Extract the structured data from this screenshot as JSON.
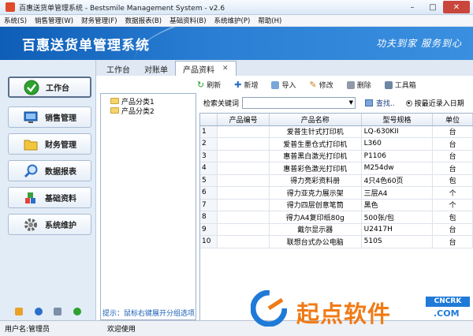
{
  "window": {
    "title": "百惠送货单管理系统 - Bestsmile Management System - v2.6",
    "controls": [
      "minimize",
      "maximize",
      "close"
    ]
  },
  "menubar": {
    "items": [
      "系统(S)",
      "销售管理(W)",
      "财务管理(F)",
      "数据报表(B)",
      "基础资料(B)",
      "系统维护(P)",
      "帮助(H)"
    ]
  },
  "banner": {
    "title": "百惠送货单管理系统",
    "slogan": "功夫到家 服务到心"
  },
  "sidebar": {
    "buttons": [
      {
        "label": "工作台",
        "icon": "check-circle-icon",
        "color": "#2ea12e"
      },
      {
        "label": "销售管理",
        "icon": "monitor-icon",
        "color": "#2a6fc9"
      },
      {
        "label": "财务管理",
        "icon": "folder-icon",
        "color": "#e8b92c"
      },
      {
        "label": "数据报表",
        "icon": "magnifier-icon",
        "color": "#2a6fc9"
      },
      {
        "label": "基础资料",
        "icon": "blocks-icon",
        "color": "#3c8f3c"
      },
      {
        "label": "系统维护",
        "icon": "gear-icon",
        "color": "#555555"
      }
    ]
  },
  "tabs": [
    {
      "label": "工作台",
      "active": false
    },
    {
      "label": "对账单",
      "active": false
    },
    {
      "label": "产品资料",
      "active": true
    }
  ],
  "toolbar": {
    "refresh": "刷新",
    "add": "新增",
    "import": "导入",
    "edit": "修改",
    "delete": "删除",
    "toolbox": "工具箱"
  },
  "tree": {
    "items": [
      "产品分类1",
      "产品分类2"
    ],
    "hint": "提示：鼠标右键展开分组选项"
  },
  "search": {
    "label": "检索关键词",
    "value": "",
    "find_label": "查找..",
    "radio_label": "按最近录入日期"
  },
  "table": {
    "headers": [
      "",
      "产品编号",
      "产品名称",
      "型号规格",
      "单位"
    ],
    "rows": [
      {
        "n": "1",
        "code": "",
        "name": "爱普生针式打印机",
        "model": "LQ-630KII",
        "unit": "台"
      },
      {
        "n": "2",
        "code": "",
        "name": "爱普生墨仓式打印机",
        "model": "L360",
        "unit": "台"
      },
      {
        "n": "3",
        "code": "",
        "name": "惠普黑白激光打印机",
        "model": "P1106",
        "unit": "台"
      },
      {
        "n": "4",
        "code": "",
        "name": "惠普彩色激光打印机",
        "model": "M254dw",
        "unit": "台"
      },
      {
        "n": "5",
        "code": "",
        "name": "得力亮彩资料册",
        "model": "4只4色60页",
        "unit": "包"
      },
      {
        "n": "6",
        "code": "",
        "name": "得力亚克力展示架",
        "model": "三层A4",
        "unit": "个"
      },
      {
        "n": "7",
        "code": "",
        "name": "得力四层创意笔筒",
        "model": "黑色",
        "unit": "个"
      },
      {
        "n": "8",
        "code": "",
        "name": "得力A4复印纸80g",
        "model": "500张/包",
        "unit": "包"
      },
      {
        "n": "9",
        "code": "",
        "name": "戴尔显示器",
        "model": "U2417H",
        "unit": "台"
      },
      {
        "n": "10",
        "code": "",
        "name": "联想台式办公电脑",
        "model": "510S",
        "unit": "台"
      }
    ]
  },
  "statusbar": {
    "user": "用户名:管理员",
    "welcome": "欢迎使用"
  },
  "watermark": {
    "text": "起点软件",
    "badge": "CNCRK",
    "domain": ".COM"
  },
  "colors": {
    "banner": "#1f6fc8",
    "accent": "#1a5fb4",
    "watermark": "#f07a16"
  }
}
